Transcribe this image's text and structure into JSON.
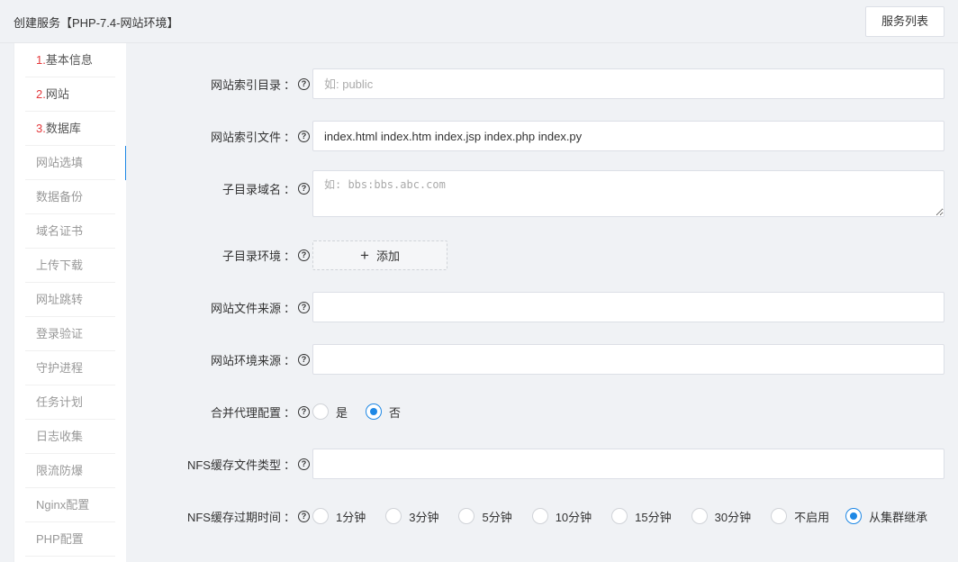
{
  "header": {
    "title": "创建服务【PHP-7.4-网站环境】",
    "list_button": "服务列表"
  },
  "sidebar": {
    "items": [
      {
        "num": "1.",
        "label": "基本信息"
      },
      {
        "num": "2.",
        "label": "网站"
      },
      {
        "num": "3.",
        "label": "数据库"
      },
      {
        "num": "",
        "label": "网站选填"
      },
      {
        "num": "",
        "label": "数据备份"
      },
      {
        "num": "",
        "label": "域名证书"
      },
      {
        "num": "",
        "label": "上传下载"
      },
      {
        "num": "",
        "label": "网址跳转"
      },
      {
        "num": "",
        "label": "登录验证"
      },
      {
        "num": "",
        "label": "守护进程"
      },
      {
        "num": "",
        "label": "任务计划"
      },
      {
        "num": "",
        "label": "日志收集"
      },
      {
        "num": "",
        "label": "限流防爆"
      },
      {
        "num": "",
        "label": "Nginx配置"
      },
      {
        "num": "",
        "label": "PHP配置"
      }
    ],
    "active_index": 3
  },
  "form": {
    "index_dir": {
      "label": "网站索引目录",
      "placeholder": "如: public",
      "value": ""
    },
    "index_files": {
      "label": "网站索引文件",
      "value": "index.html index.htm index.jsp index.php index.py"
    },
    "subdir_domain": {
      "label": "子目录域名",
      "placeholder": "如: bbs:bbs.abc.com"
    },
    "subdir_env": {
      "label": "子目录环境",
      "add_label": "添加"
    },
    "file_source": {
      "label": "网站文件来源",
      "value": ""
    },
    "env_source": {
      "label": "网站环境来源",
      "value": ""
    },
    "merge_proxy": {
      "label": "合并代理配置",
      "options": [
        "是",
        "否"
      ],
      "selected": "否"
    },
    "nfs_types": {
      "label": "NFS缓存文件类型",
      "value": ""
    },
    "nfs_expire": {
      "label": "NFS缓存过期时间",
      "options": [
        "1分钟",
        "3分钟",
        "5分钟",
        "10分钟",
        "15分钟",
        "30分钟",
        "不启用",
        "从集群继承"
      ],
      "selected": "从集群继承"
    },
    "help_glyph": "?"
  },
  "colors": {
    "accent": "#1e88e5",
    "step_number": "#e4393c"
  }
}
